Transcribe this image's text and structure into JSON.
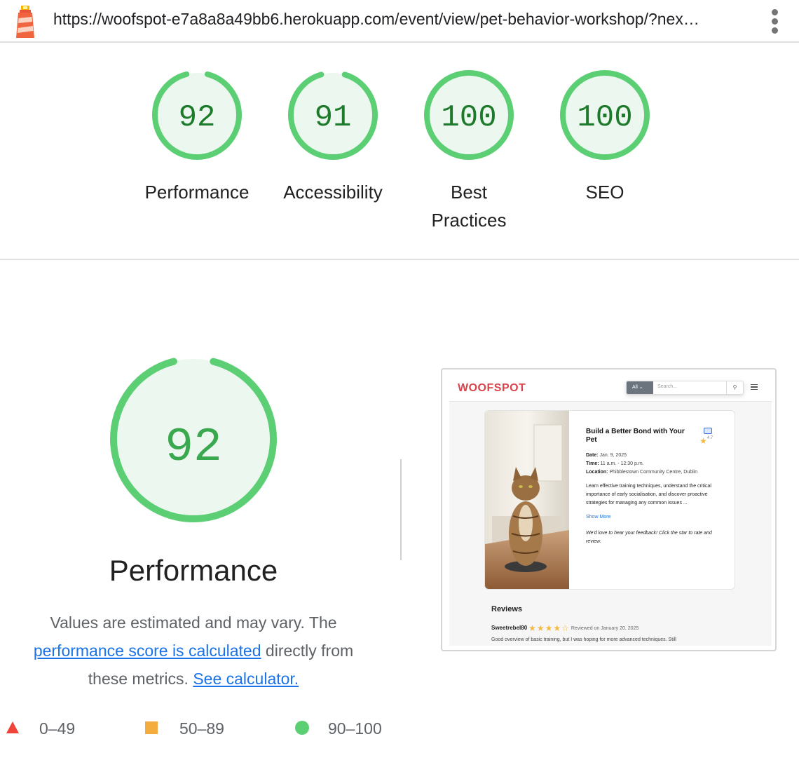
{
  "header": {
    "url": "https://woofspot-e7a8a8a49bb6.herokuapp.com/event/view/pet-behavior-workshop/?nex…",
    "logo_icon": "lighthouse-icon",
    "menu_icon": "more-vert-icon"
  },
  "categories": [
    {
      "label": "Performance",
      "score": "92",
      "value": 92
    },
    {
      "label": "Accessibility",
      "score": "91",
      "value": 91
    },
    {
      "label": "Best Practices",
      "score": "100",
      "value": 100
    },
    {
      "label": "SEO",
      "score": "100",
      "value": 100
    }
  ],
  "detail": {
    "score": "92",
    "value": 92,
    "title": "Performance",
    "desc_prefix": "Values are estimated and may vary. The ",
    "desc_link": "performance score is calculated",
    "desc_mid": " directly from these metrics. ",
    "desc_link2": "See calculator."
  },
  "legend": [
    {
      "range": "0–49",
      "shape": "triangle",
      "color": "#ff4e42"
    },
    {
      "range": "50–89",
      "shape": "square",
      "color": "#ffa400"
    },
    {
      "range": "90–100",
      "shape": "circle",
      "color": "#0cce6b"
    }
  ],
  "colors": {
    "pass_ring": "#5ccf74",
    "pass_fill": "#ecf8ef",
    "pass_text_dark": "#1d7a2a",
    "pass_text_light": "#3aa84e",
    "link": "#1a73e8"
  },
  "screenshot": {
    "brand": "WOOFSPOT",
    "search_category": "All",
    "search_placeholder": "Search...",
    "event_title": "Build a Better Bond with Your Pet",
    "rating": "4.7",
    "date_label": "Date:",
    "date": "Jan. 9, 2025",
    "time_label": "Time:",
    "time": "11 a.m. - 12:30 p.m.",
    "location_label": "Location:",
    "location": "Phibblestown Community Centre, Dublin",
    "description": "Learn effective training techniques, understand the critical importance of early socialisation, and discover proactive strategies for managing any common issues ...",
    "show_more": "Show More",
    "feedback": "We'd love to hear your feedback! Click the star to rate and review.",
    "reviews_heading": "Reviews",
    "reviewer": "Sweetrebel80",
    "review_stars": "★★★★☆",
    "review_date": "Reviewed on January 20, 2025",
    "review_text": "Good overview of basic training, but I was hoping for more advanced techniques. Still"
  }
}
